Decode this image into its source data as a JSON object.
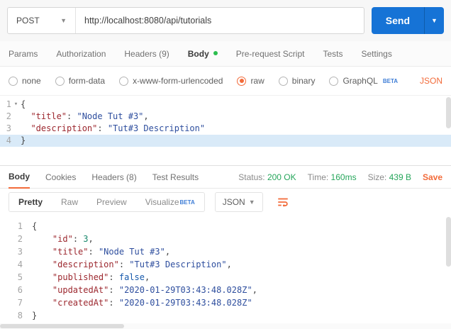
{
  "colors": {
    "accent_orange": "#f26b3a",
    "send_blue": "#1673d6",
    "status_green": "#26a65b",
    "beta_blue": "#3e7dd6",
    "body_dot_green": "#2cbe4e",
    "active_line_blue": "#d9eaf8"
  },
  "request_bar": {
    "method": "POST",
    "url": "http://localhost:8080/api/tutorials",
    "send_label": "Send"
  },
  "request_tabs": [
    {
      "label": "Params"
    },
    {
      "label": "Authorization"
    },
    {
      "label": "Headers (9)"
    },
    {
      "label": "Body"
    },
    {
      "label": "Pre-request Script"
    },
    {
      "label": "Tests"
    },
    {
      "label": "Settings"
    }
  ],
  "body_options": [
    {
      "label": "none"
    },
    {
      "label": "form-data"
    },
    {
      "label": "x-www-form-urlencoded"
    },
    {
      "label": "raw"
    },
    {
      "label": "binary"
    },
    {
      "label": "GraphQL",
      "badge": "BETA"
    }
  ],
  "raw_language": "JSON",
  "request_editor": {
    "lines": [
      {
        "fold": true,
        "tokens": [
          [
            "punct",
            "{"
          ]
        ]
      },
      {
        "tokens": [
          [
            "ws",
            "  "
          ],
          [
            "key",
            "\"title\""
          ],
          [
            "punct",
            ": "
          ],
          [
            "str",
            "\"Node Tut #3\""
          ],
          [
            "punct",
            ","
          ]
        ]
      },
      {
        "tokens": [
          [
            "ws",
            "  "
          ],
          [
            "key",
            "\"description\""
          ],
          [
            "punct",
            ": "
          ],
          [
            "str",
            "\"Tut#3 Description\""
          ]
        ]
      },
      {
        "highlight": true,
        "tokens": [
          [
            "punct",
            "}"
          ]
        ]
      }
    ]
  },
  "response_meta": {
    "tabs": [
      "Body",
      "Cookies",
      "Headers (8)",
      "Test Results"
    ],
    "status_label": "Status:",
    "status_value": "200 OK",
    "time_label": "Time:",
    "time_value": "160ms",
    "size_label": "Size:",
    "size_value": "439 B",
    "save_label": "Save"
  },
  "response_toolbar": {
    "views": [
      "Pretty",
      "Raw",
      "Preview",
      "Visualize"
    ],
    "visualize_badge": "BETA",
    "language": "JSON"
  },
  "response_editor": {
    "lines": [
      {
        "tokens": [
          [
            "punct",
            "{"
          ]
        ]
      },
      {
        "tokens": [
          [
            "ws",
            "    "
          ],
          [
            "key",
            "\"id\""
          ],
          [
            "punct",
            ": "
          ],
          [
            "num",
            "3"
          ],
          [
            "punct",
            ","
          ]
        ]
      },
      {
        "tokens": [
          [
            "ws",
            "    "
          ],
          [
            "key",
            "\"title\""
          ],
          [
            "punct",
            ": "
          ],
          [
            "str",
            "\"Node Tut #3\""
          ],
          [
            "punct",
            ","
          ]
        ]
      },
      {
        "tokens": [
          [
            "ws",
            "    "
          ],
          [
            "key",
            "\"description\""
          ],
          [
            "punct",
            ": "
          ],
          [
            "str",
            "\"Tut#3 Description\""
          ],
          [
            "punct",
            ","
          ]
        ]
      },
      {
        "tokens": [
          [
            "ws",
            "    "
          ],
          [
            "key",
            "\"published\""
          ],
          [
            "punct",
            ": "
          ],
          [
            "kw",
            "false"
          ],
          [
            "punct",
            ","
          ]
        ]
      },
      {
        "tokens": [
          [
            "ws",
            "    "
          ],
          [
            "key",
            "\"updatedAt\""
          ],
          [
            "punct",
            ": "
          ],
          [
            "str",
            "\"2020-01-29T03:43:48.028Z\""
          ],
          [
            "punct",
            ","
          ]
        ]
      },
      {
        "tokens": [
          [
            "ws",
            "    "
          ],
          [
            "key",
            "\"createdAt\""
          ],
          [
            "punct",
            ": "
          ],
          [
            "str",
            "\"2020-01-29T03:43:48.028Z\""
          ]
        ]
      },
      {
        "tokens": [
          [
            "punct",
            "}"
          ]
        ]
      }
    ]
  }
}
